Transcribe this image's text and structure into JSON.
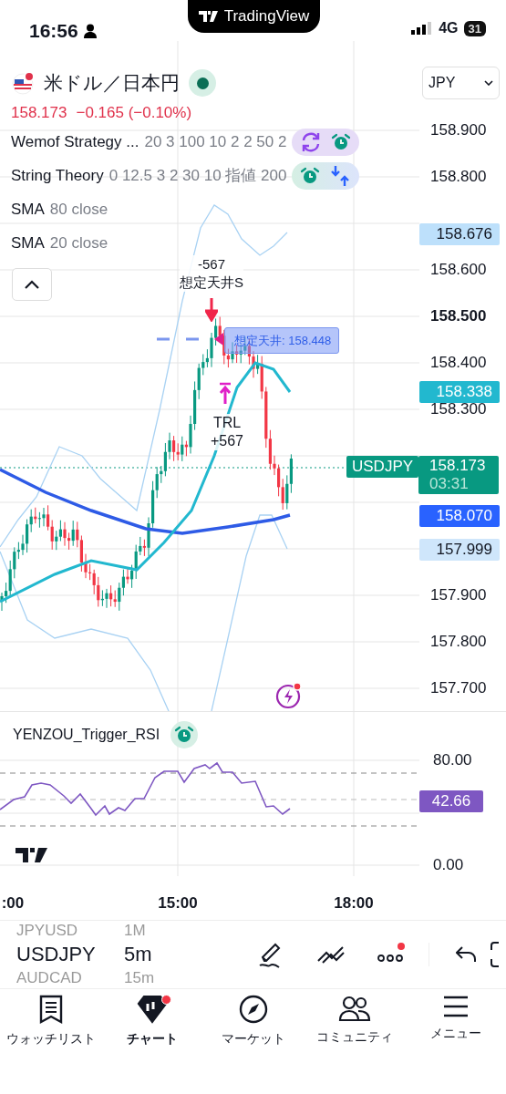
{
  "status_bar": {
    "time": "16:56",
    "network": "4G",
    "battery": "31"
  },
  "notch": {
    "brand": "TradingView"
  },
  "symbol": {
    "name": "米ドル／日本円",
    "market_open": true,
    "price": "158.173",
    "change": "−0.165 (−0.10%)"
  },
  "currency_menu": {
    "value": "JPY"
  },
  "indicators": [
    {
      "kind": "strategy",
      "name": "Wemof Strategy ...",
      "params": "20 3 100 10 2 2 50 2"
    },
    {
      "kind": "signals",
      "name": "String Theory",
      "params": "0 12.5 3 2 30 10 指値 200"
    },
    {
      "kind": "study",
      "name": "SMA",
      "params": "80 close"
    },
    {
      "kind": "study",
      "name": "SMA",
      "params": "20 close"
    }
  ],
  "price_axis": {
    "labels": [
      {
        "text": "158.900",
        "bold": false
      },
      {
        "text": "158.800",
        "bold": false
      },
      {
        "text": "158.600",
        "bold": false
      },
      {
        "text": "158.500",
        "bold": true
      },
      {
        "text": "158.400",
        "bold": false
      },
      {
        "text": "158.300",
        "bold": false
      },
      {
        "text": "157.900",
        "bold": false
      },
      {
        "text": "157.800",
        "bold": false
      },
      {
        "text": "157.700",
        "bold": false
      }
    ]
  },
  "price_tags": [
    {
      "text": "158.676",
      "color": "#bde0fb"
    },
    {
      "text": "158.338",
      "color": "#22b8cf"
    },
    {
      "text": "158.070",
      "color": "#2962ff"
    },
    {
      "text": "157.999",
      "color": "#cfe6fb"
    }
  ],
  "last_price": {
    "symbol": "USDJPY",
    "price": "158.173",
    "countdown": "03:31"
  },
  "annotations": [
    {
      "kind": "entry",
      "lines": [
        "-567",
        "想定天井S"
      ]
    },
    {
      "kind": "level",
      "text": "想定天井: 158.448"
    },
    {
      "kind": "exit",
      "lines": [
        "TRL",
        "+567"
      ]
    }
  ],
  "rsi": {
    "name": "YENZOU_Trigger_RSI",
    "axis": [
      "80.00",
      "0.00"
    ],
    "value": "42.66"
  },
  "time_axis": [
    ":00",
    "15:00",
    "18:00"
  ],
  "symbol_picker": [
    {
      "symbol": "JPYUSD",
      "interval": "1M",
      "selected": false
    },
    {
      "symbol": "USDJPY",
      "interval": "5m",
      "selected": true
    },
    {
      "symbol": "AUDCAD",
      "interval": "15m",
      "selected": false
    }
  ],
  "tools": {
    "more_has_news": true
  },
  "tabs": [
    {
      "label": "ウォッチリスト",
      "selected": false,
      "badge": false
    },
    {
      "label": "チャート",
      "selected": true,
      "badge": true
    },
    {
      "label": "マーケット",
      "selected": false,
      "badge": false
    },
    {
      "label": "コミュニティ",
      "selected": false,
      "badge": false
    },
    {
      "label": "メニュー",
      "selected": false,
      "badge": false
    }
  ]
}
